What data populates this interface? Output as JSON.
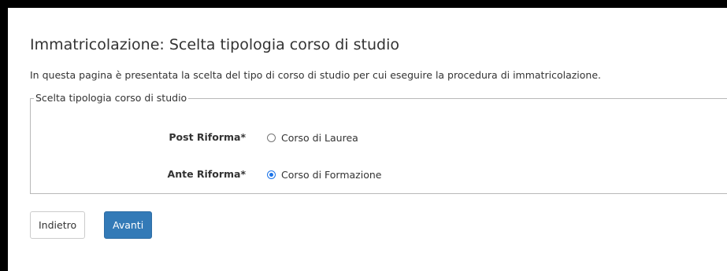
{
  "page": {
    "title": "Immatricolazione: Scelta tipologia corso di studio",
    "intro": "In questa pagina è presentata la scelta del tipo di corso di studio per cui eseguire la procedura di immatricolazione."
  },
  "fieldset": {
    "legend": "Scelta tipologia corso di studio",
    "rows": [
      {
        "label": "Post Riforma*",
        "option": "Corso di Laurea",
        "selected": false
      },
      {
        "label": "Ante Riforma*",
        "option": "Corso di Formazione",
        "selected": true
      }
    ]
  },
  "buttons": {
    "back_label": "Indietro",
    "next_label": "Avanti"
  },
  "colors": {
    "primary_button": "#337ab7",
    "radio_checked": "#1a73e8",
    "frame": "#000000"
  }
}
